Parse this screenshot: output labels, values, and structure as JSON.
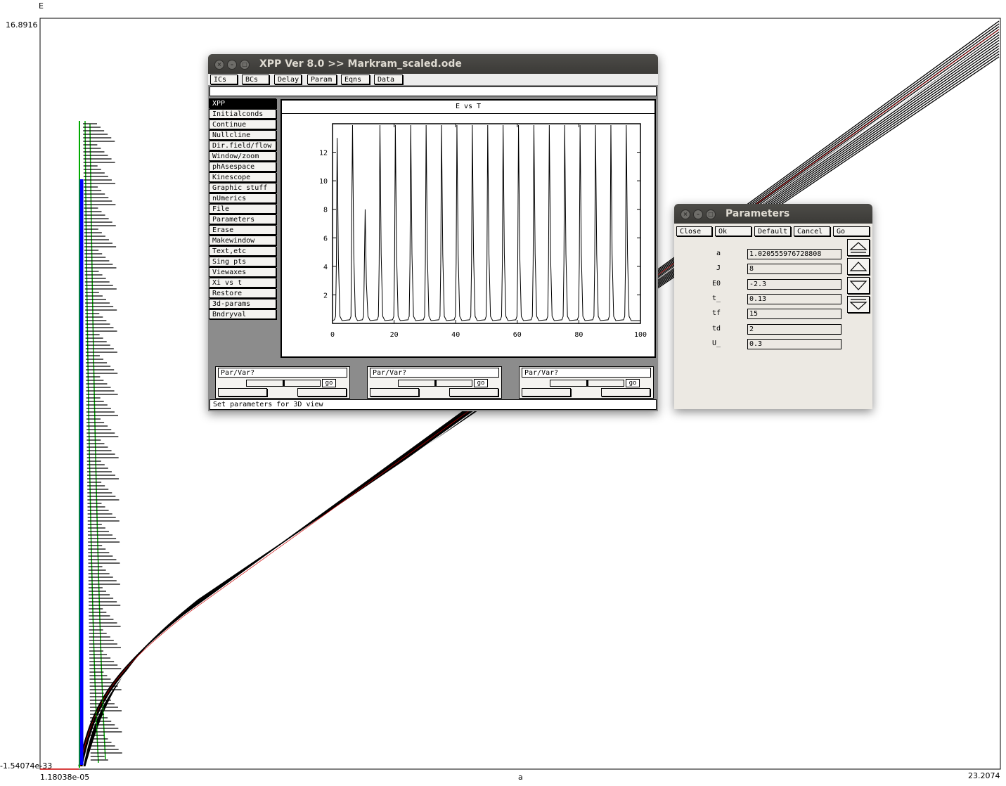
{
  "bifurcation_plot": {
    "y_axis_variable": "E",
    "y_max_label": "16.8916",
    "y_min_label": "-1.54074e-33",
    "x_axis_variable": "a",
    "x_min_label": "1.18038e-05",
    "x_max_label": "23.2074",
    "colors": {
      "stable": "#000000",
      "unstable_blue": "#0000ff",
      "green": "#00aa00",
      "red": "#cc0000"
    }
  },
  "xpp_window": {
    "title": "XPP Ver 8.0 >> Markram_scaled.ode",
    "menu": [
      "ICs",
      "BCs",
      "Delay",
      "Param",
      "Eqns",
      "Data"
    ],
    "side_menu": [
      "XPP",
      "Initialconds",
      "Continue",
      "Nullcline",
      "Dir.field/flow",
      "Window/zoom",
      "phAsespace",
      "Kinescope",
      "Graphic stuff",
      "nUmerics",
      "File",
      "Parameters",
      "Erase",
      "Makewindow",
      "Text,etc",
      "Sing pts",
      "Viewaxes",
      "Xi vs t",
      "Restore",
      "3d-params",
      "Bndryval"
    ],
    "graph_title": "E vs T",
    "sliders": [
      {
        "label": "Par/Var?",
        "go": "go"
      },
      {
        "label": "Par/Var?",
        "go": "go"
      },
      {
        "label": "Par/Var?",
        "go": "go"
      }
    ],
    "status": "Set parameters for 3D view"
  },
  "chart_data": {
    "type": "line",
    "title": "E vs T",
    "xlabel": "",
    "ylabel": "",
    "xlim": [
      0,
      100
    ],
    "ylim": [
      0,
      14
    ],
    "x_ticks": [
      0,
      20,
      40,
      60,
      80,
      100
    ],
    "y_ticks": [
      2,
      4,
      6,
      8,
      10,
      12
    ],
    "series": [
      {
        "peak_times": [
          1.5,
          6.5,
          10.6,
          15.4,
          20.4,
          25.4,
          30.4,
          35.4,
          40.4,
          45.4,
          50.4,
          55.4,
          60.4,
          65.4,
          70.4,
          75.4,
          80.4,
          85.4,
          90.4,
          95.4
        ],
        "peak_values": [
          13.0,
          13.9,
          8.0,
          13.9,
          13.9,
          13.9,
          13.9,
          13.9,
          13.9,
          13.9,
          13.9,
          13.9,
          13.9,
          13.9,
          13.9,
          13.9,
          13.9,
          13.9,
          13.9,
          13.9
        ],
        "pre_peak_values": [
          4.2,
          8.0,
          0,
          4.2,
          4.2,
          4.2,
          4.2,
          4.2,
          4.2,
          4.2,
          4.2,
          4.2,
          4.2,
          4.2,
          4.2,
          4.2,
          4.2,
          4.2,
          4.2,
          4.2
        ],
        "baseline": 0.2
      }
    ]
  },
  "parameters_window": {
    "title": "Parameters",
    "buttons": [
      "Close",
      "Ok",
      "Default",
      "Cancel",
      "Go"
    ],
    "params": [
      {
        "name": "a",
        "value": "1.020555976728808"
      },
      {
        "name": "J",
        "value": "8"
      },
      {
        "name": "E0",
        "value": "-2.3"
      },
      {
        "name": "t_",
        "value": "0.13"
      },
      {
        "name": "tf",
        "value": "15"
      },
      {
        "name": "td",
        "value": "2"
      },
      {
        "name": "U_",
        "value": "0.3"
      }
    ]
  }
}
